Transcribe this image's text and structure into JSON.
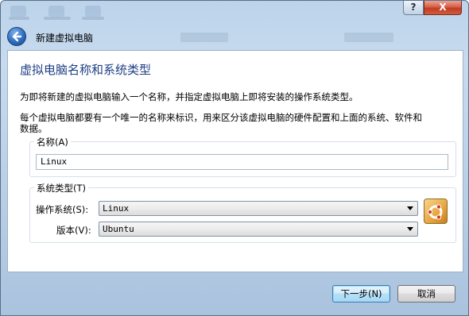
{
  "window": {
    "help_label": "?",
    "close_label": "X"
  },
  "header": {
    "title": "新建虚拟电脑"
  },
  "page": {
    "heading": "虚拟电脑名称和系统类型",
    "desc1": "为即将新建的虚拟电脑输入一个名称，并指定虚拟电脑上即将安装的操作系统类型。",
    "desc2_line1": "每个虚拟电脑都要有一个唯一的名称来标识，用来区分该虚拟电脑的硬件配置和上面的系统、软件和",
    "desc2_line2": "数据。"
  },
  "name_group": {
    "title": "名称(A)",
    "value": "Linux"
  },
  "os_group": {
    "title": "系统类型(T)",
    "os_label": "操作系统(S):",
    "os_value": "Linux",
    "version_label": "版本(V):",
    "version_value": "Ubuntu",
    "os_icon": "ubuntu-logo-icon"
  },
  "buttons": {
    "next": "下一步(N)",
    "cancel": "取消"
  },
  "colors": {
    "heading": "#1f3f86",
    "window_frame": "#bcd3ea",
    "close": "#c13c24"
  }
}
